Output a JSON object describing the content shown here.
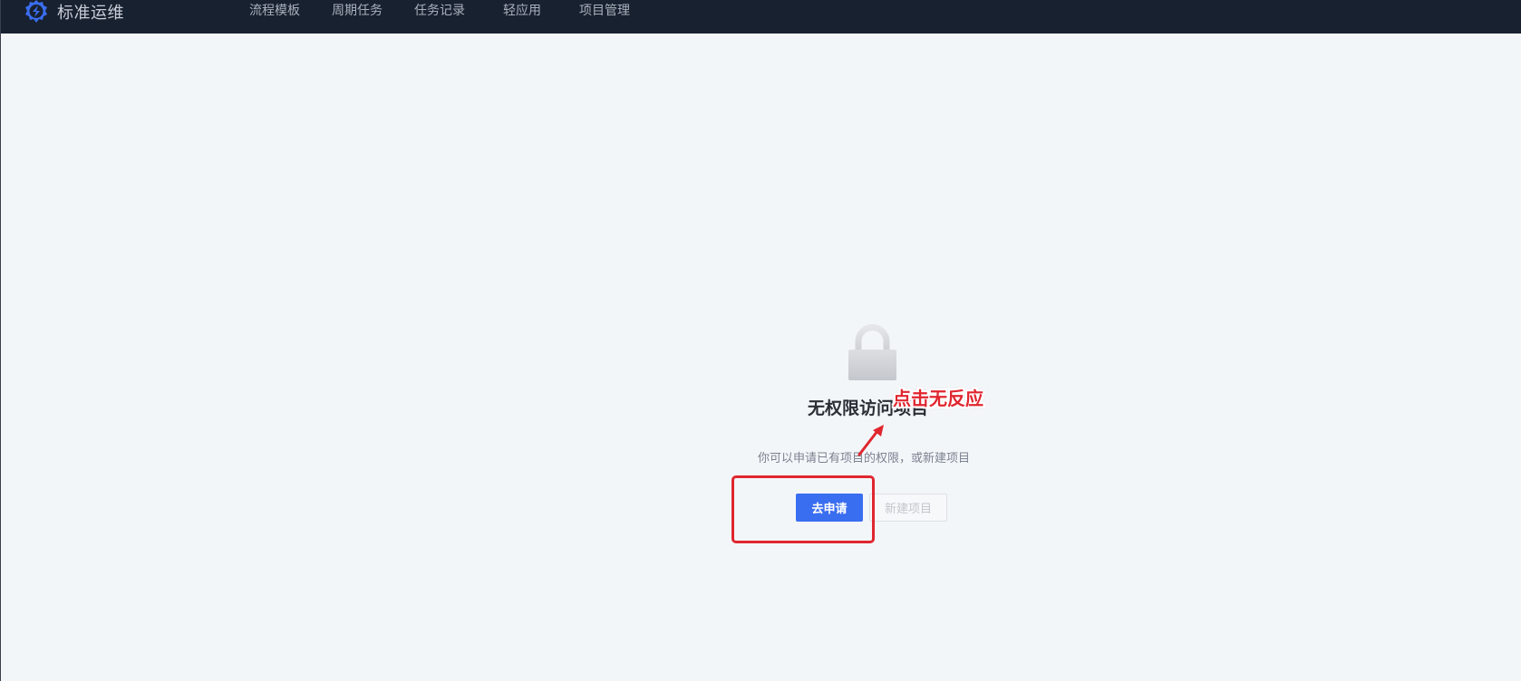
{
  "brand": {
    "name": "标准运维",
    "logo_icon": "gear-bolt-icon",
    "logo_color": "#3a6ef0"
  },
  "nav": {
    "items": [
      {
        "label": "流程模板"
      },
      {
        "label": "周期任务"
      },
      {
        "label": "任务记录"
      },
      {
        "label": "轻应用"
      },
      {
        "label": "项目管理"
      }
    ]
  },
  "empty_state": {
    "icon": "lock-icon",
    "title": "无权限访问项目",
    "subtitle": "你可以申请已有项目的权限，或新建项目",
    "apply_button": "去申请",
    "create_button": "新建项目"
  },
  "annotation": {
    "text": "点击无反应",
    "color": "#e0262f"
  },
  "colors": {
    "topbar": "#182130",
    "background": "#f3f6f9",
    "primary": "#3a6ef0"
  }
}
